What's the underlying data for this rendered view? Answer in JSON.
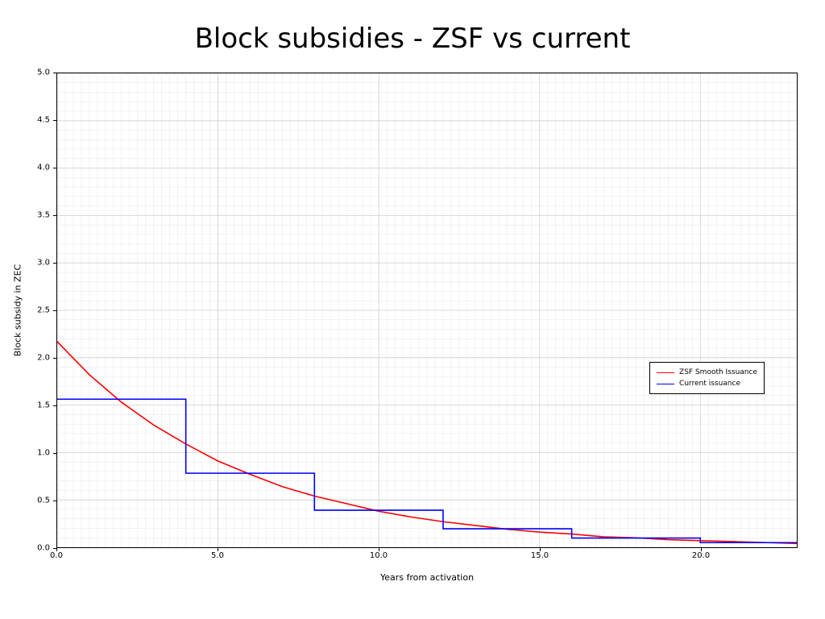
{
  "chart_data": {
    "type": "line",
    "title": "Block subsidies - ZSF vs current",
    "xlabel": "Years from activation",
    "ylabel": "Block subsidy in ZEC",
    "xlim": [
      0,
      23
    ],
    "ylim": [
      0,
      5.0
    ],
    "xticks": [
      0.0,
      5.0,
      10.0,
      15.0,
      20.0
    ],
    "yticks": [
      0.0,
      0.5,
      1.0,
      1.5,
      2.0,
      2.5,
      3.0,
      3.5,
      4.0,
      4.5,
      5.0
    ],
    "xtick_labels": [
      "0.0",
      "5.0",
      "10.0",
      "15.0",
      "20.0"
    ],
    "ytick_labels": [
      "0.0",
      "0.5",
      "1.0",
      "1.5",
      "2.0",
      "2.5",
      "3.0",
      "3.5",
      "4.0",
      "4.5",
      "5.0"
    ],
    "legend": {
      "position": "right-middle",
      "entries": [
        "ZSF Smooth Issuance",
        "Current issuance"
      ]
    },
    "colors": {
      "zsf": "#ff0000",
      "current": "#0000ff"
    },
    "series": [
      {
        "name": "ZSF Smooth Issuance",
        "color": "#ff0000",
        "x": [
          0,
          1,
          2,
          3,
          4,
          5,
          6,
          7,
          8,
          9,
          10,
          11,
          12,
          13,
          14,
          15,
          16,
          17,
          18,
          19,
          20,
          21,
          22,
          23
        ],
        "y": [
          2.17,
          1.82,
          1.53,
          1.29,
          1.09,
          0.91,
          0.77,
          0.64,
          0.54,
          0.46,
          0.38,
          0.32,
          0.27,
          0.23,
          0.19,
          0.16,
          0.14,
          0.11,
          0.1,
          0.08,
          0.07,
          0.06,
          0.05,
          0.04
        ]
      },
      {
        "name": "Current issuance",
        "color": "#0000ff",
        "type": "step",
        "x": [
          0,
          4,
          4,
          8,
          8,
          12,
          12,
          16,
          16,
          20,
          20,
          23
        ],
        "y": [
          1.5625,
          1.5625,
          0.78125,
          0.78125,
          0.390625,
          0.390625,
          0.1953125,
          0.1953125,
          0.09765625,
          0.09765625,
          0.048828125,
          0.048828125
        ]
      }
    ]
  }
}
